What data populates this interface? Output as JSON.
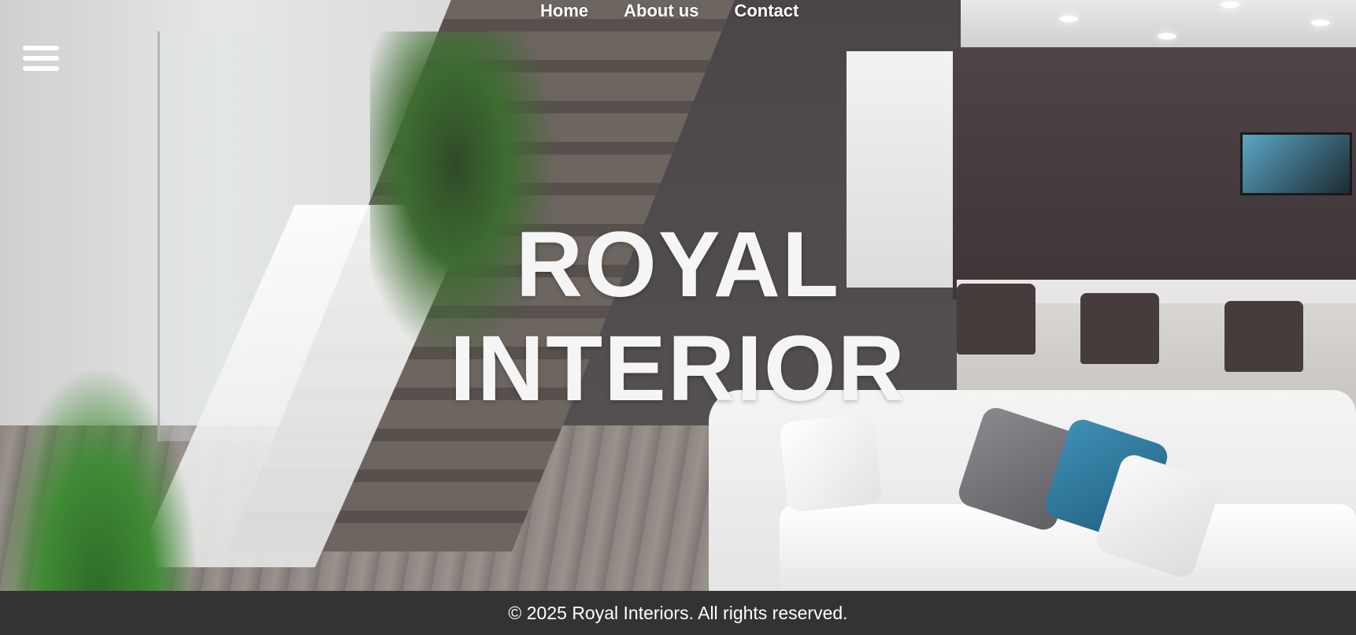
{
  "nav": {
    "menu_icon": "hamburger-menu-icon",
    "links": [
      {
        "label": "Home"
      },
      {
        "label": "About us"
      },
      {
        "label": "Contact"
      }
    ]
  },
  "hero": {
    "title_line1": "ROYAL",
    "title_line2": "INTERIOR",
    "background": "interior photo: staircase, kitchen, white sofa"
  },
  "footer": {
    "text": "© 2025 Royal Interiors. All rights reserved."
  },
  "colors": {
    "footer_bg": "#333333",
    "nav_text": "#ffffff",
    "title_text": "#f5f5f5"
  }
}
